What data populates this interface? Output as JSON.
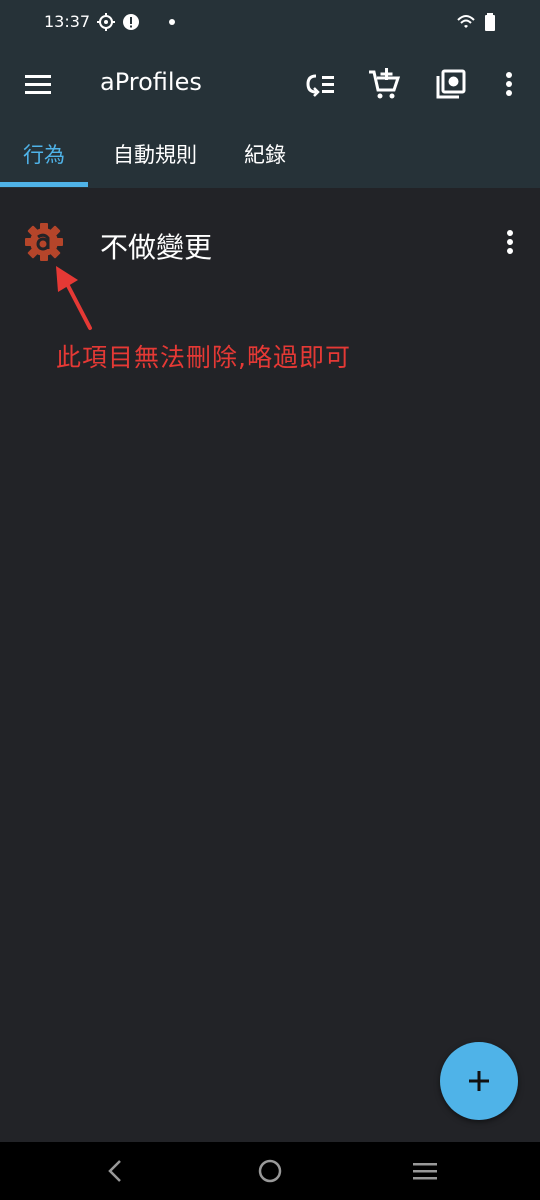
{
  "status_bar": {
    "time": "13:37",
    "icons": [
      "settings-gear-icon",
      "alert-icon",
      "dot-icon",
      "wifi-icon",
      "battery-icon"
    ]
  },
  "appbar": {
    "title": "aProfiles",
    "icons": [
      "menu-icon",
      "reorder-icon",
      "add-to-cart-icon",
      "library-icon",
      "more-vert-icon"
    ]
  },
  "tabs": [
    {
      "label": "行為",
      "active": true
    },
    {
      "label": "自動規則",
      "active": false
    },
    {
      "label": "紀錄",
      "active": false
    }
  ],
  "list": {
    "items": [
      {
        "label": "不做變更",
        "icon": "aprofiles-gear-icon"
      }
    ]
  },
  "annotation": {
    "text": "此項目無法刪除,略過即可"
  },
  "fab": {
    "icon": "plus-icon"
  },
  "navbar": {
    "icons": [
      "back-icon",
      "home-icon",
      "recents-icon"
    ]
  },
  "colors": {
    "background": "#222327",
    "bar": "#263238",
    "accent": "#4fb3e8",
    "annotation": "#e53935",
    "item_icon": "#b5452a"
  }
}
